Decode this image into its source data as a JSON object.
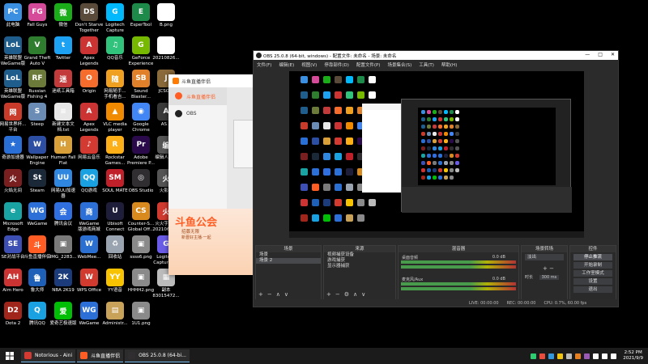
{
  "desktop": {
    "icons": [
      {
        "label": "此电脑",
        "color": "#3b8fe0",
        "glyph": "PC"
      },
      {
        "label": "英雄联盟\nWeGame版",
        "color": "#1f5d8c",
        "glyph": "LoL"
      },
      {
        "label": "英雄联盟\nWeGame版",
        "color": "#1f5d8c",
        "glyph": "LoL"
      },
      {
        "label": "网易世界杯...\n平台",
        "color": "#c83a2a",
        "glyph": "网"
      },
      {
        "label": "奇游加速器",
        "color": "#2a6fd6",
        "glyph": "★"
      },
      {
        "label": "火焰无间",
        "color": "#7a1f1f",
        "glyph": "火"
      },
      {
        "label": "Microsoft\nEdge",
        "color": "#1aa3a3",
        "glyph": "e"
      },
      {
        "label": "SE对战平台",
        "color": "#3e4fb3",
        "glyph": "SE"
      },
      {
        "label": "Aim Hero",
        "color": "#c33",
        "glyph": "AH"
      },
      {
        "label": "Dota 2",
        "color": "#a0261c",
        "glyph": "D2"
      },
      {
        "label": "Fall Guys",
        "color": "#d64a9a",
        "glyph": "FG"
      },
      {
        "label": "Grand Theft\nAuto V",
        "color": "#2f7d2f",
        "glyph": "V"
      },
      {
        "label": "Russian\nFishing 4",
        "color": "#6c7a3a",
        "glyph": "RF"
      },
      {
        "label": "Steep",
        "color": "#6b8db5",
        "glyph": "S"
      },
      {
        "label": "Wallpaper\nEngine",
        "color": "#2c4fa3",
        "glyph": "W"
      },
      {
        "label": "Steam",
        "color": "#1b2838",
        "glyph": "St"
      },
      {
        "label": "WeGame",
        "color": "#2c6fd6",
        "glyph": "WG"
      },
      {
        "label": "斗鱼直播伴侣",
        "color": "#ff5d23",
        "glyph": "斗"
      },
      {
        "label": "鲁大师",
        "color": "#1e5fb8",
        "glyph": "鲁"
      },
      {
        "label": "腾讯QQ",
        "color": "#1aa1e2",
        "glyph": "Q"
      },
      {
        "label": "微信",
        "color": "#1aad19",
        "glyph": "微"
      },
      {
        "label": "Twitter",
        "color": "#1da1f2",
        "glyph": "t"
      },
      {
        "label": "迷纸工具箱",
        "color": "#c23a3a",
        "glyph": "迷"
      },
      {
        "label": "新建文本文\n档.txt",
        "color": "#e8e8e8",
        "glyph": "≡"
      },
      {
        "label": "Human Fall\nFlat",
        "color": "#d9a03a",
        "glyph": "H"
      },
      {
        "label": "网易UU加速\n器",
        "color": "#2f87e0",
        "glyph": "UU"
      },
      {
        "label": "腾讯会议",
        "color": "#2f6fe0",
        "glyph": "会"
      },
      {
        "label": "IMG_2283...",
        "color": "#7a7a7a",
        "glyph": "▣"
      },
      {
        "label": "NBA 2K19",
        "color": "#1c3b7a",
        "glyph": "2K"
      },
      {
        "label": "爱奇艺极速版",
        "color": "#00be06",
        "glyph": "爱"
      },
      {
        "label": "Don't Starve\nTogether",
        "color": "#5a4a3a",
        "glyph": "DS"
      },
      {
        "label": "Apex\nLegends",
        "color": "#c33",
        "glyph": "A"
      },
      {
        "label": "Origin",
        "color": "#f56c2d",
        "glyph": "O"
      },
      {
        "label": "Apex\nLegends",
        "color": "#c33",
        "glyph": "A"
      },
      {
        "label": "网易云音乐",
        "color": "#d33a31",
        "glyph": "♪"
      },
      {
        "label": "QQ游戏",
        "color": "#1aa1e2",
        "glyph": "QQ"
      },
      {
        "label": "WeGame\n版游戏商城",
        "color": "#2c6fd6",
        "glyph": "商"
      },
      {
        "label": "WebMee...",
        "color": "#2b6fd1",
        "glyph": "W"
      },
      {
        "label": "WPS Office",
        "color": "#d13b2f",
        "glyph": "W"
      },
      {
        "label": "WeGame",
        "color": "#2c6fd6",
        "glyph": "WG"
      },
      {
        "label": "Logitech\nCapture",
        "color": "#00b8fc",
        "glyph": "G"
      },
      {
        "label": "QQ音乐",
        "color": "#31c27c",
        "glyph": "♫"
      },
      {
        "label": "网易随手...\n手机看吉...",
        "color": "#f0a020",
        "glyph": "随"
      },
      {
        "label": "VLC media\nplayer",
        "color": "#f08a00",
        "glyph": "▲"
      },
      {
        "label": "Rockstar\nGames...",
        "color": "#fcaf17",
        "glyph": "R"
      },
      {
        "label": "SOUL MATE",
        "color": "#c0202a",
        "glyph": "SM"
      },
      {
        "label": "Ubisoft\nConnect",
        "color": "#1e1e3a",
        "glyph": "U"
      },
      {
        "label": "回收站",
        "color": "#9aa4b0",
        "glyph": "♻"
      },
      {
        "label": "YY语音",
        "color": "#f7c300",
        "glyph": "YY"
      },
      {
        "label": "Administr...",
        "color": "#c9a25a",
        "glyph": "▤"
      },
      {
        "label": "EsperTool",
        "color": "#1e8a4a",
        "glyph": "E"
      },
      {
        "label": "GeForce\nExperience",
        "color": "#76b900",
        "glyph": "G"
      },
      {
        "label": "Sound\nBlaster...",
        "color": "#e0802a",
        "glyph": "SB"
      },
      {
        "label": "Google\nChrome",
        "color": "#4285f4",
        "glyph": "◉"
      },
      {
        "label": "Adobe\nPremiere P...",
        "color": "#2a0a4a",
        "glyph": "Pr"
      },
      {
        "label": "OBS Studio",
        "color": "#302e31",
        "glyph": "◎"
      },
      {
        "label": "Counter-S...\nGlobal Off...",
        "color": "#d98a1f",
        "glyph": "CS"
      },
      {
        "label": "ssss6.png",
        "color": "#8a8a8a",
        "glyph": "▣"
      },
      {
        "label": "HHHH2.png",
        "color": "#8a8a8a",
        "glyph": "▣"
      },
      {
        "label": "1U1.png",
        "color": "#8a8a8a",
        "glyph": "▣"
      },
      {
        "label": "B.png",
        "color": "#ffffff",
        "glyph": ""
      },
      {
        "label": "20210826...",
        "color": "#ffffff",
        "glyph": ""
      },
      {
        "label": "JCSG...",
        "color": "#8a6a3a",
        "glyph": "J"
      },
      {
        "label": "AS...",
        "color": "#3a3a3a",
        "glyph": "A"
      },
      {
        "label": "编辑人员...",
        "color": "#555",
        "glyph": "编"
      },
      {
        "label": "火影...",
        "color": "#555",
        "glyph": "火"
      },
      {
        "label": "火火字体...\n20210629...",
        "color": "#d13b2f",
        "glyph": "火"
      },
      {
        "label": "Logitech\nCapture (2)",
        "color": "#6b5ce7",
        "glyph": "G"
      },
      {
        "label": "副本\n83015472...",
        "color": "#bbbbbb",
        "glyph": "▦"
      }
    ]
  },
  "douyu_dialog": {
    "title": "斗鱼直播伴侣",
    "nav": [
      {
        "label": "斗鱼直播伴侣",
        "active": true
      },
      {
        "label": "OBS",
        "active": false
      }
    ],
    "banner_title": "斗鱼公会",
    "banner_line1": "招募无限",
    "banner_line2": "新晋好主播·一起"
  },
  "obs": {
    "title": "OBS 25.0.8 (64-bit, windows) - 配置文件: 未命名 - 场景: 未命名",
    "menu": [
      "文件(F)",
      "编辑(E)",
      "视图(V)",
      "停靠部件(D)",
      "配置文件(P)",
      "场景集合(S)",
      "工具(T)",
      "帮助(H)"
    ],
    "window_buttons": [
      "—",
      "□",
      "✕"
    ],
    "scenes": {
      "title": "场景",
      "items": [
        "场景",
        "场景 2"
      ]
    },
    "sources": {
      "title": "来源",
      "items": [
        "视频捕获设备",
        "游戏捕获",
        "显示器捕获"
      ]
    },
    "mixer": {
      "title": "混音器",
      "channels": [
        {
          "name": "麦克风/Aux",
          "db": "0.0 dB"
        },
        {
          "name": "桌面音频",
          "db": "0.0 dB"
        }
      ]
    },
    "transitions": {
      "title": "场景转场",
      "type": "淡出",
      "duration_label": "时长",
      "duration": "300 ms"
    },
    "controls": {
      "title": "控件",
      "buttons": [
        "停止推流",
        "开始录制",
        "工作室模式",
        "设置",
        "退出"
      ]
    },
    "status": [
      "LIVE: 00:00:00",
      "REC: 00:00:00",
      "CPU: 0.7%, 60.00 fps"
    ],
    "tools_symbols": [
      "+",
      "−",
      "∧",
      "∨"
    ]
  },
  "taskbar": {
    "items": [
      {
        "label": "Notorious - Aini",
        "color": "#d33a31"
      },
      {
        "label": "斗鱼直播伴侣",
        "color": "#ff5d23"
      },
      {
        "label": "OBS 25.0.8 (64-bi...",
        "color": "#302e31"
      }
    ],
    "time": "2:52 PM",
    "date": "2021/9/9",
    "tray_colors": [
      "#2ecc71",
      "#e74c3c",
      "#3498db",
      "#f1c40f",
      "#bbbbbb",
      "#e67e22",
      "#9b59b6",
      "#ffffff",
      "#ffffff",
      "#ffffff"
    ]
  }
}
